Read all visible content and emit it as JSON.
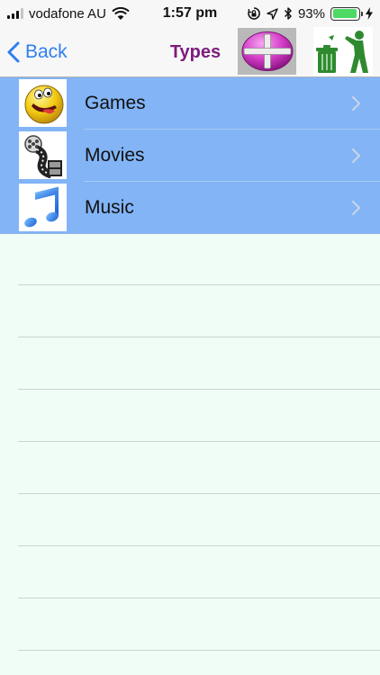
{
  "status_bar": {
    "carrier": "vodafone AU",
    "time": "1:57 pm",
    "battery_percent": "93%",
    "battery_level": 0.93
  },
  "nav": {
    "back_label": "Back",
    "title": "Types"
  },
  "list": {
    "items": [
      {
        "label": "Games",
        "icon": "pacman-icon"
      },
      {
        "label": "Movies",
        "icon": "film-reel-icon"
      },
      {
        "label": "Music",
        "icon": "music-note-icon"
      }
    ]
  },
  "colors": {
    "accent": "#2f7ff0",
    "title": "#7d1c7d",
    "row_background": "#82b4f6",
    "page_background": "#effdf6"
  }
}
